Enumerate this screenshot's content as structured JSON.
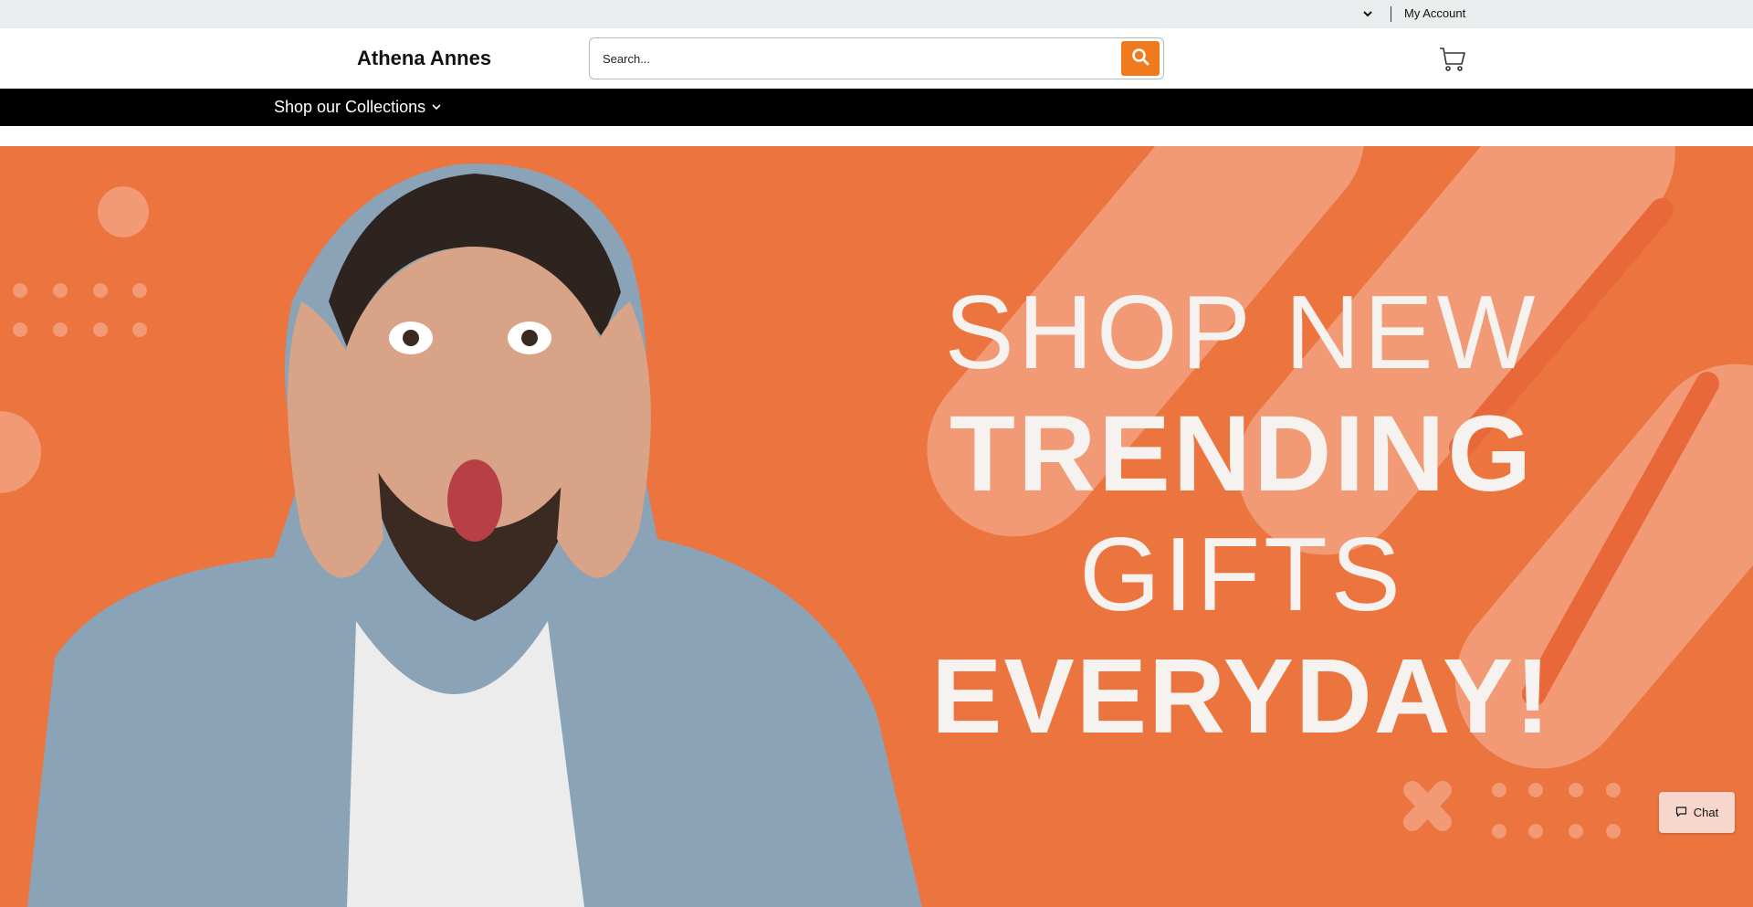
{
  "topbar": {
    "account_label": "My Account",
    "dropdown_icon": "chevron-down-icon"
  },
  "header": {
    "store_name": "Athena Annes",
    "search": {
      "placeholder": "Search...",
      "value": "",
      "icon": "search-icon"
    },
    "cart_icon": "cart-icon"
  },
  "nav": {
    "collections_label": "Shop our Collections",
    "collections_icon": "chevron-down-icon"
  },
  "hero": {
    "line1": "SHOP NEW",
    "line2": "TRENDING",
    "line3": "GIFTS",
    "line4": "EVERYDAY!",
    "background_color": "#ec743f"
  },
  "chat": {
    "label": "Chat",
    "icon": "chat-bubble-icon"
  },
  "colors": {
    "accent": "#f07b1f",
    "nav_bg": "#000000",
    "topbar_bg": "#e9eded"
  }
}
